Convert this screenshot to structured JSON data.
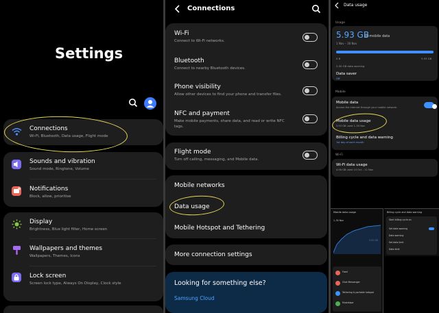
{
  "settings": {
    "title": "Settings",
    "items": [
      {
        "title": "Connections",
        "sub": "Wi-Fi, Bluetooth, Data usage, Flight mode"
      },
      {
        "title": "Sounds and vibration",
        "sub": "Sound mode, Ringtone, Volume"
      },
      {
        "title": "Notifications",
        "sub": "Block, allow, prioritise"
      },
      {
        "title": "Display",
        "sub": "Brightness, Blue light filter, Home screen"
      },
      {
        "title": "Wallpapers and themes",
        "sub": "Wallpapers, Themes, Icons"
      },
      {
        "title": "Lock screen",
        "sub": "Screen lock type, Always On Display, Clock style"
      }
    ],
    "colors": {
      "connections": "#4f8cff",
      "sounds": "#7b6cf2",
      "notifications": "#e8675a",
      "display": "#8bc34a",
      "wallpapers": "#a86cf2",
      "lock": "#7b6cf2"
    }
  },
  "connections": {
    "title": "Connections",
    "wifi": {
      "title": "Wi-Fi",
      "sub": "Connect to Wi-Fi networks."
    },
    "bluetooth": {
      "title": "Bluetooth",
      "sub": "Connect to nearby Bluetooth devices."
    },
    "phone_visibility": {
      "title": "Phone visibility",
      "sub": "Allow other devices to find your phone and transfer files."
    },
    "nfc": {
      "title": "NFC and payment",
      "sub1": "Make mobile payments, share data, and read or write NFC",
      "sub2": "tags."
    },
    "flight": {
      "title": "Flight mode",
      "sub": "Turn off calling, messaging, and Mobile data."
    },
    "mobile_networks": "Mobile networks",
    "data_usage": "Data usage",
    "hotspot": "Mobile Hotspot and Tethering",
    "more": "More connection settings",
    "looking": "Looking for something else?",
    "samsung_cloud": "Samsung Cloud"
  },
  "data_usage": {
    "title": "Data usage",
    "usage_label": "Usage",
    "amount": "5.93 GB",
    "amount_suffix": "of mobile data",
    "period": "1 Nov – 30 Nov",
    "scale_min": "0 B",
    "scale_max": "5.93 GB",
    "warning": "2.00 GB data warning",
    "saver_title": "Data saver",
    "saver_sub": "Off",
    "mobile_label": "Mobile",
    "mobile_data_title": "Mobile data",
    "mobile_data_sub": "Access the internet through your mobile network.",
    "mobile_usage_title": "Mobile data usage",
    "mobile_usage_sub": "5.93 GB used 1–30 Nov",
    "billing_title": "Billing cycle and data warning",
    "billing_sub": "1st day of each month",
    "wifi_label": "Wi-Fi",
    "wifi_usage_title": "Wi-Fi data usage",
    "wifi_usage_sub": "4.56 GB used 14 Oct – 11 Nov"
  },
  "mini_usage": {
    "title": "Mobile data usage",
    "period": "1–30 Nov",
    "amount": "5.93 GB",
    "apps": [
      "Food",
      "Chat Messenger",
      "Tethering & portable hotspot",
      "Musixtape"
    ]
  },
  "mini_billing": {
    "title": "Billing cycle and data warning",
    "rows": [
      "Start billing cycle on",
      "Set data warning",
      "Data warning",
      "Set data limit",
      "Data limit"
    ]
  }
}
